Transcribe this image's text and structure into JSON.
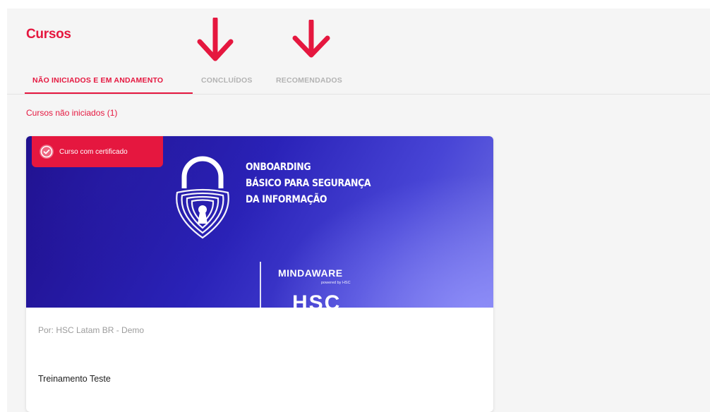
{
  "page": {
    "title": "Cursos"
  },
  "tabs": [
    {
      "label": "NÃO INICIADOS E EM ANDAMENTO",
      "active": true
    },
    {
      "label": "CONCLUÍDOS",
      "active": false
    },
    {
      "label": "RECOMENDADOS",
      "active": false
    }
  ],
  "annotations": {
    "arrow_icon": "down-arrow",
    "arrow_color": "#e5173f"
  },
  "section": {
    "label": "Cursos não iniciados (1)"
  },
  "course_card": {
    "badge": {
      "icon": "certificate-seal-icon",
      "label": "Curso com certificado"
    },
    "banner": {
      "title_lines": [
        "ONBOARDING",
        "BÁSICO PARA SEGURANÇA",
        "DA INFORMAÇÃO"
      ],
      "brand": "MINDAWARE",
      "brand_sub": "powered by HSC",
      "brand_logo": "HSC",
      "icon": "fingerprint-padlock-icon"
    },
    "author": "Por: HSC Latam BR - Demo",
    "title": "Treinamento Teste"
  },
  "colors": {
    "accent": "#e5173f",
    "muted": "#b3b3b3",
    "panel": "#f5f5f5"
  }
}
